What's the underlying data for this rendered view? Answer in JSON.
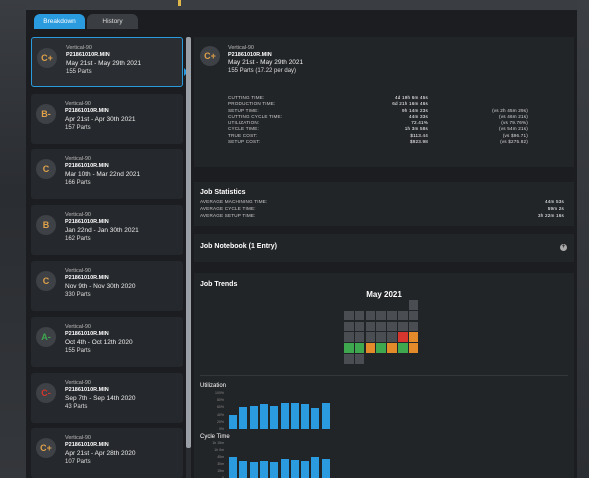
{
  "tabs": {
    "breakdown": "Breakdown",
    "history": "History"
  },
  "jobs": [
    {
      "grade": "C+",
      "grade_color": "#e0a24a",
      "machine": "Vertical-90",
      "file": "P21861010R.MIN",
      "dates": "May 21st - May 29th 2021",
      "parts": "155 Parts"
    },
    {
      "grade": "B-",
      "grade_color": "#e0a24a",
      "machine": "Vertical-90",
      "file": "P21861010R.MIN",
      "dates": "Apr 21st - Apr 30th 2021",
      "parts": "157 Parts"
    },
    {
      "grade": "C",
      "grade_color": "#e0a24a",
      "machine": "Vertical-90",
      "file": "P21861010R.MIN",
      "dates": "Mar 10th - Mar 22nd 2021",
      "parts": "166 Parts"
    },
    {
      "grade": "B",
      "grade_color": "#e0a24a",
      "machine": "Vertical-90",
      "file": "P21861010R.MIN",
      "dates": "Jan 22nd - Jan 30th 2021",
      "parts": "162 Parts"
    },
    {
      "grade": "C",
      "grade_color": "#e0a24a",
      "machine": "Vertical-90",
      "file": "P21861010R.MIN",
      "dates": "Nov 9th - Nov 30th 2020",
      "parts": "330 Parts"
    },
    {
      "grade": "A-",
      "grade_color": "#3ea84f",
      "machine": "Vertical-90",
      "file": "P21861010R.MIN",
      "dates": "Oct 4th - Oct 12th 2020",
      "parts": "155 Parts"
    },
    {
      "grade": "C-",
      "grade_color": "#d6362e",
      "machine": "Vertical-90",
      "file": "P21861010R.MIN",
      "dates": "Sep 7th - Sep 14th 2020",
      "parts": "43 Parts"
    },
    {
      "grade": "C+",
      "grade_color": "#e0a24a",
      "machine": "Vertical-90",
      "file": "P21861010R.MIN",
      "dates": "Apr 21st - Apr 28th 2020",
      "parts": "107 Parts"
    }
  ],
  "summary": {
    "grade": "C+",
    "grade_color": "#e0a24a",
    "machine": "Vertical-90",
    "file": "P21861010R.MIN",
    "dates": "May 21st - May 29th 2021",
    "parts": "155 Parts (17.22 per day)",
    "metrics": [
      {
        "label": "CUTTING TIME:",
        "value": "4d 19h 6m 45s",
        "compare": ""
      },
      {
        "label": "PRODUCTION TIME:",
        "value": "6d 21h 16m 46s",
        "compare": ""
      },
      {
        "label": "SETUP TIME:",
        "value": "9h 14m 23s",
        "compare": "(vs 2h 45m 29s)"
      },
      {
        "label": "CUTTING CYCLE TIME:",
        "value": "44m 33s",
        "compare": "(vs 46m 21s)"
      },
      {
        "label": "UTILIZATION:",
        "value": "72.41%",
        "compare": "(vs 79.76%)"
      },
      {
        "label": "CYCLE TIME:",
        "value": "1h 3m 58s",
        "compare": "(vs 54m 21s)"
      },
      {
        "label": "TRUE COST:",
        "value": "$113.44",
        "compare": "(vs $96.71)"
      },
      {
        "label": "SETUP COST:",
        "value": "$923.98",
        "compare": "(vs $275.82)"
      }
    ]
  },
  "statistics": {
    "title": "Job Statistics",
    "rows": [
      {
        "label": "AVERAGE MACHINING TIME:",
        "value": "44m 53s"
      },
      {
        "label": "AVERAGE CYCLE TIME:",
        "value": "59m 2s"
      },
      {
        "label": "AVERAGE SETUP TIME:",
        "value": "3h 22m 16s"
      }
    ]
  },
  "notebook": {
    "title": "Job Notebook (1 Entry)"
  },
  "trends": {
    "title": "Job Trends",
    "month": "May 2021",
    "calendar_colors": {
      "default": "#4a4d52",
      "green": "#3ea84f",
      "orange": "#e38a2a",
      "red": "#d6362e"
    },
    "utilization_label": "Utilization",
    "utilization_ticks": [
      "100%",
      "80%",
      "60%",
      "40%",
      "20%",
      "0%"
    ],
    "utilization_values": [
      40,
      60,
      65,
      70,
      63,
      73,
      72,
      69,
      59,
      71
    ],
    "cycle_label": "Cycle Time",
    "cycle_ticks": [
      "1h 15m",
      "1h 0m",
      "45m",
      "30m",
      "15m",
      "0"
    ],
    "cycle_values": [
      60,
      48,
      46,
      50,
      47,
      54,
      51,
      48,
      61,
      53
    ]
  }
}
